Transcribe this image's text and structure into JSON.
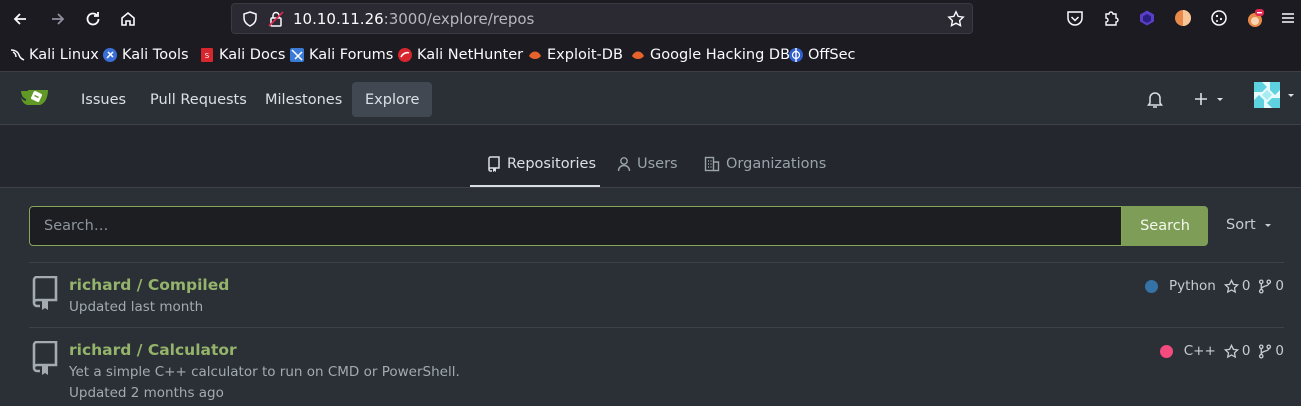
{
  "browser": {
    "url_host": "10.10.11.26",
    "url_path": ":3000/explore/repos",
    "bookmarks": [
      {
        "label": "Kali Linux",
        "icon": "kali-dragon-icon"
      },
      {
        "label": "Kali Tools",
        "icon": "kali-tools-icon"
      },
      {
        "label": "Kali Docs",
        "icon": "kali-docs-icon"
      },
      {
        "label": "Kali Forums",
        "icon": "kali-forums-icon"
      },
      {
        "label": "Kali NetHunter",
        "icon": "kali-nethunter-icon"
      },
      {
        "label": "Exploit-DB",
        "icon": "exploit-db-icon"
      },
      {
        "label": "Google Hacking DB",
        "icon": "ghdb-icon"
      },
      {
        "label": "OffSec",
        "icon": "offsec-icon"
      }
    ]
  },
  "header": {
    "nav": [
      "Issues",
      "Pull Requests",
      "Milestones",
      "Explore"
    ],
    "active": "Explore"
  },
  "tabs": [
    {
      "label": "Repositories",
      "icon": "repo-icon"
    },
    {
      "label": "Users",
      "icon": "user-icon"
    },
    {
      "label": "Organizations",
      "icon": "organization-icon"
    }
  ],
  "search": {
    "placeholder": "Search…",
    "button": "Search",
    "sort": "Sort"
  },
  "repos": [
    {
      "name": "richard / Compiled",
      "description": "",
      "updated": "Updated last month",
      "language": "Python",
      "language_color": "#3572A5",
      "stars": "0",
      "forks": "0"
    },
    {
      "name": "richard / Calculator",
      "description": "Yet a simple C++ calculator to run on CMD or PowerShell.",
      "updated": "Updated 2 months ago",
      "language": "C++",
      "language_color": "#f34b7d",
      "stars": "0",
      "forks": "0"
    }
  ],
  "colors": {
    "accent": "#7e9e57",
    "link": "#95b46b"
  }
}
